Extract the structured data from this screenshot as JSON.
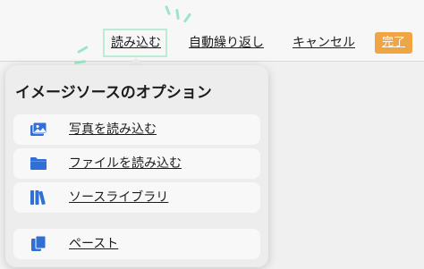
{
  "toolbar": {
    "import_label": "読み込む",
    "wrap_label": "自動繰り返し",
    "cancel_label": "キャンセル",
    "done_label": "完了"
  },
  "popover": {
    "title": "イメージソースのオプション",
    "options": [
      {
        "label": "写真を読み込む",
        "icon": "photo-icon"
      },
      {
        "label": "ファイルを読み込む",
        "icon": "folder-icon"
      },
      {
        "label": "ソースライブラリ",
        "icon": "library-icon"
      },
      {
        "label": "ペースト",
        "icon": "clipboard-icon"
      }
    ]
  },
  "colors": {
    "accent": "#f0a545",
    "icon_blue": "#2f6fd6",
    "highlight": "#b8ecd3"
  }
}
